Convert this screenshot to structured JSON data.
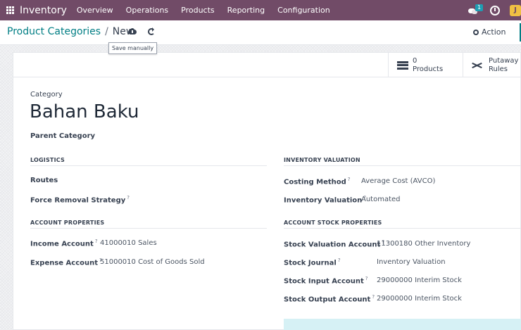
{
  "navbar": {
    "app_name": "Inventory",
    "menu": [
      "Overview",
      "Operations",
      "Products",
      "Reporting",
      "Configuration"
    ],
    "chat_badge": "1",
    "avatar_initial": "J"
  },
  "control": {
    "breadcrumb_parent": "Product Categories",
    "breadcrumb_separator": "/",
    "breadcrumb_current": "New",
    "action_label": "Action",
    "save_tooltip": "Save manually"
  },
  "stat_buttons": {
    "products_count": "0",
    "products_label": "Products",
    "putaway_line1": "Putaway",
    "putaway_line2": "Rules"
  },
  "form": {
    "category_label": "Category",
    "category_name": "Bahan Baku",
    "parent_category_label": "Parent Category",
    "logistics": {
      "heading": "LOGISTICS",
      "routes_label": "Routes",
      "force_removal_label": "Force Removal Strategy"
    },
    "inventory_valuation": {
      "heading": "INVENTORY VALUATION",
      "costing_method_label": "Costing Method",
      "costing_method_value": "Average Cost (AVCO)",
      "valuation_label": "Inventory Valuation",
      "valuation_value": "Automated"
    },
    "account_properties": {
      "heading": "ACCOUNT PROPERTIES",
      "income_label": "Income Account",
      "income_value": "41000010 Sales",
      "expense_label": "Expense Account",
      "expense_value": "51000010 Cost of Goods Sold"
    },
    "account_stock_properties": {
      "heading": "ACCOUNT STOCK PROPERTIES",
      "valuation_account_label": "Stock Valuation Account",
      "valuation_account_value": "11300180 Other Inventory",
      "journal_label": "Stock Journal",
      "journal_value": "Inventory Valuation",
      "input_label": "Stock Input Account",
      "input_value": "29000000 Interim Stock",
      "output_label": "Stock Output Account",
      "output_value": "29000000 Interim Stock"
    },
    "help_mark": "?"
  },
  "colors": {
    "navbar": "#714b67",
    "link": "#017e84",
    "badge": "#1f9db3",
    "avatar": "#f0c043",
    "info_block": "#d6f1f5"
  }
}
